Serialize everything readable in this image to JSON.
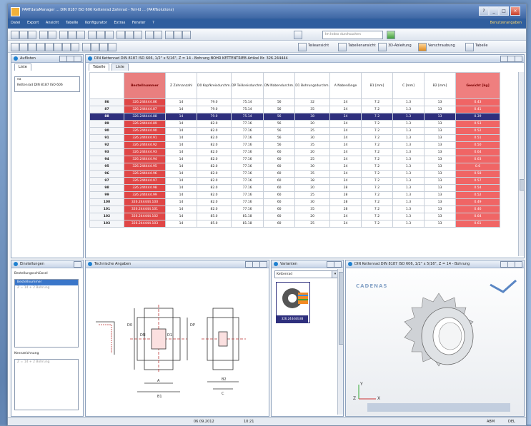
{
  "window": {
    "title": "PARTdataManager ... DIN 8187 ISO 606 Kettenrad Zahnrad - Teil-Id ... (PARTsolutions)",
    "title_right": "PARTsolutions",
    "colors": {
      "title": "#3d66a3",
      "menu": "#2f5e9e",
      "order_col": "#e04646",
      "selected_row": "#2e2f7d"
    }
  },
  "menu": {
    "items": [
      "Datei",
      "Export",
      "Ansicht",
      "Tabelle",
      "Konfigurator",
      "Extras",
      "Fenster",
      "?"
    ],
    "right_text": "Benutzerangaben"
  },
  "toolbar": {
    "search_placeholder": "Im Index durchsuchen",
    "buttons": [
      "Teileansicht",
      "Tabellenansicht",
      "3D-Ableitung",
      "Verschraubung",
      "Tabelle"
    ]
  },
  "index_panel": {
    "title": "Auflisten",
    "tab": "Liste",
    "tree_root": "Kettenrad DIN 8187 ISO 606"
  },
  "table_panel": {
    "title": "DIN Kettenrad DIN 8187 ISO 606, 1/2\" x 5/16\", Z = 14 - Bohrung BOHR KETTENTRIEB Artikel Nr. 326.244444",
    "tabs": [
      "Tabelle",
      "Liste"
    ],
    "columns": [
      {
        "key": "row",
        "label": ""
      },
      {
        "key": "order",
        "label": "Bestellnummer"
      },
      {
        "key": "z",
        "label": "Z Zahnanzahl"
      },
      {
        "key": "d0",
        "label": "D0 Kopfkreisdurchm."
      },
      {
        "key": "dp",
        "label": "DP Teilkreisdurchm."
      },
      {
        "key": "dn",
        "label": "DN Nabendurchm."
      },
      {
        "key": "d1",
        "label": "D1 Bohrungsdurchm."
      },
      {
        "key": "a",
        "label": "A Nabenlänge"
      },
      {
        "key": "b1",
        "label": "B1 [mm]"
      },
      {
        "key": "c",
        "label": "C [mm]"
      },
      {
        "key": "b2",
        "label": "B2 [mm]"
      },
      {
        "key": "weight",
        "label": "Gewicht [kg]"
      }
    ],
    "rows": [
      [
        "86",
        "326.244444.86",
        "14",
        "79.0",
        "75.14",
        "56",
        "32",
        "24",
        "7.2",
        "1.3",
        "13",
        "0.43"
      ],
      [
        "87",
        "326.244444.87",
        "14",
        "79.0",
        "75.14",
        "56",
        "35",
        "24",
        "7.2",
        "1.3",
        "13",
        "0.41"
      ],
      [
        "88",
        "326.244444.88",
        "14",
        "79.0",
        "75.14",
        "56",
        "38",
        "24",
        "7.2",
        "1.3",
        "13",
        "0.39"
      ],
      [
        "89",
        "326.244444.89",
        "14",
        "82.0",
        "77.16",
        "56",
        "20",
        "24",
        "7.2",
        "1.3",
        "13",
        "0.53"
      ],
      [
        "90",
        "326.244444.90",
        "14",
        "82.0",
        "77.16",
        "56",
        "25",
        "24",
        "7.2",
        "1.3",
        "13",
        "0.52"
      ],
      [
        "91",
        "326.244444.91",
        "14",
        "82.0",
        "77.16",
        "56",
        "30",
        "24",
        "7.2",
        "1.3",
        "13",
        "0.51"
      ],
      [
        "92",
        "326.244444.92",
        "14",
        "82.0",
        "77.16",
        "56",
        "35",
        "24",
        "7.2",
        "1.3",
        "13",
        "0.50"
      ],
      [
        "93",
        "326.244444.93",
        "14",
        "82.0",
        "77.16",
        "60",
        "20",
        "24",
        "7.2",
        "1.3",
        "13",
        "0.64"
      ],
      [
        "94",
        "326.244444.94",
        "14",
        "82.0",
        "77.16",
        "60",
        "25",
        "24",
        "7.2",
        "1.3",
        "13",
        "0.63"
      ],
      [
        "95",
        "326.244444.95",
        "14",
        "82.0",
        "77.16",
        "60",
        "30",
        "24",
        "7.2",
        "1.3",
        "13",
        "0.6"
      ],
      [
        "96",
        "326.244444.96",
        "14",
        "82.0",
        "77.16",
        "60",
        "35",
        "24",
        "7.2",
        "1.3",
        "13",
        "0.58"
      ],
      [
        "97",
        "326.244444.97",
        "14",
        "82.0",
        "77.16",
        "60",
        "38",
        "24",
        "7.2",
        "1.3",
        "13",
        "0.57"
      ],
      [
        "98",
        "326.244444.98",
        "14",
        "82.0",
        "77.16",
        "60",
        "20",
        "28",
        "7.2",
        "1.3",
        "13",
        "0.54"
      ],
      [
        "99",
        "326.244444.99",
        "14",
        "82.0",
        "77.16",
        "60",
        "25",
        "28",
        "7.2",
        "1.3",
        "13",
        "0.52"
      ],
      [
        "100",
        "326.244444.100",
        "14",
        "82.0",
        "77.16",
        "60",
        "30",
        "28",
        "7.2",
        "1.3",
        "13",
        "0.49"
      ],
      [
        "101",
        "326.244444.101",
        "14",
        "82.0",
        "77.16",
        "60",
        "35",
        "28",
        "7.2",
        "1.3",
        "13",
        "0.46"
      ],
      [
        "102",
        "326.244444.102",
        "14",
        "85.0",
        "81.18",
        "60",
        "20",
        "24",
        "7.2",
        "1.3",
        "13",
        "0.64"
      ],
      [
        "103",
        "326.244444.103",
        "14",
        "85.0",
        "81.18",
        "60",
        "25",
        "24",
        "7.2",
        "1.3",
        "13",
        "0.61"
      ]
    ],
    "selected_row_index": 2
  },
  "detail_panel": {
    "title": "Einstellungen",
    "group1_label": "Bestellungsschlüssel",
    "group1_items": [
      "Bestellnummer",
      "Z = 14 + 2 Bohrung"
    ],
    "group2_label": "Kennzeichnung",
    "group2_items": [
      "Z = 14 + 2 Bohrung"
    ]
  },
  "tech_panel": {
    "title": "Technische Angaben",
    "labels": [
      "D0",
      "DP",
      "DN",
      "D1",
      "A",
      "B1",
      "B2",
      "C"
    ]
  },
  "variants_panel": {
    "title": "Varianten",
    "dropdown_value": "Kettenrad",
    "item_label": "326.244444.88"
  },
  "view3d_panel": {
    "title": "DIN Kettenrad DIN 8187 ISO 606, 1/2\" x 5/16\", Z = 14 - Bohrung",
    "logo": "CADENAS",
    "axes": [
      "X",
      "Y",
      "Z"
    ]
  },
  "statusbar": {
    "date": "06.09.2012",
    "time": "10:21",
    "mode": "ABM",
    "caps": "DEL"
  }
}
